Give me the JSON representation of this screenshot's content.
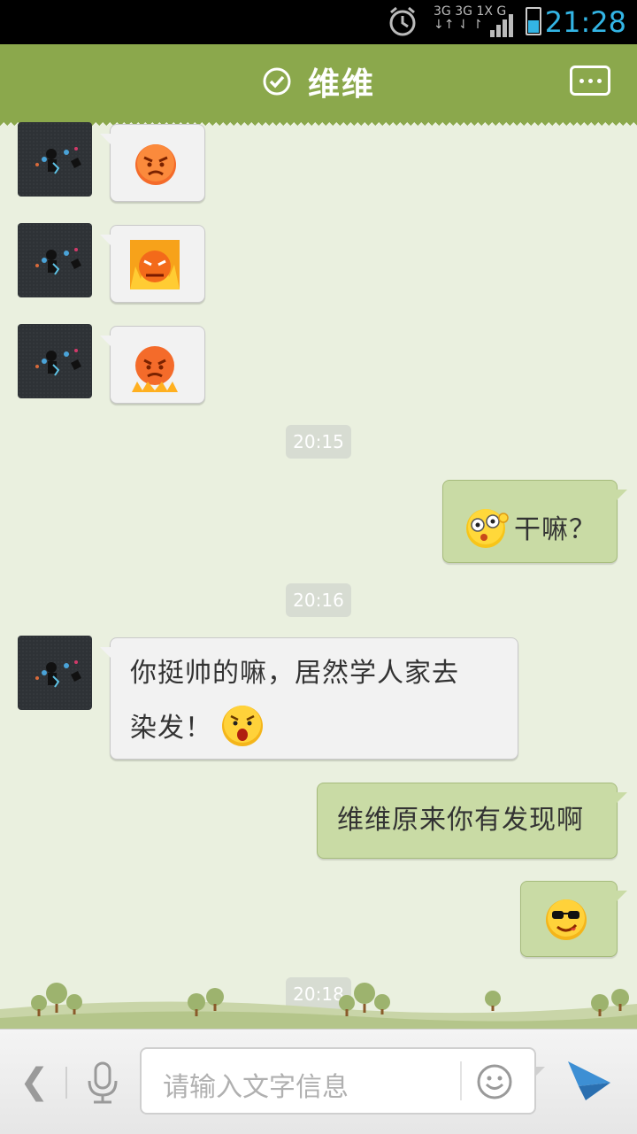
{
  "status_bar": {
    "time": "21:28",
    "network_labels": [
      "3G",
      "3G",
      "1X",
      "G"
    ]
  },
  "header": {
    "title": "维维",
    "verified_icon": "check-circle-icon",
    "more_icon": "more-dots-icon"
  },
  "messages": [
    {
      "side": "incoming",
      "type": "emoji",
      "emoji": "angry-face"
    },
    {
      "side": "incoming",
      "type": "emoji",
      "emoji": "furious-flame-face"
    },
    {
      "side": "incoming",
      "type": "emoji",
      "emoji": "angry-fire-face"
    },
    {
      "side": "timestamp",
      "text": "20:15"
    },
    {
      "side": "outgoing",
      "type": "text",
      "emoji": "dizzy-face",
      "text": "干嘛？"
    },
    {
      "side": "timestamp",
      "text": "20:16"
    },
    {
      "side": "incoming",
      "type": "text",
      "line1": "你挺帅的嘛，居然学人家去",
      "line2": "染发！",
      "emoji": "shocked-face"
    },
    {
      "side": "outgoing",
      "type": "text",
      "text": "维维原来你有发现啊"
    },
    {
      "side": "outgoing",
      "type": "emoji",
      "emoji": "cool-sunglasses-face"
    },
    {
      "side": "timestamp",
      "text": "20:18"
    }
  ],
  "input_bar": {
    "placeholder": "请输入文字信息",
    "back_icon": "chevron-left-icon",
    "mic_icon": "microphone-icon",
    "emoji_icon": "smiley-icon",
    "send_icon": "send-icon"
  },
  "colors": {
    "header": "#8ba84c",
    "background": "#eaf0df",
    "incoming_bubble": "#f2f2f2",
    "outgoing_bubble": "#c9dba5",
    "status_accent": "#33b5e5"
  }
}
